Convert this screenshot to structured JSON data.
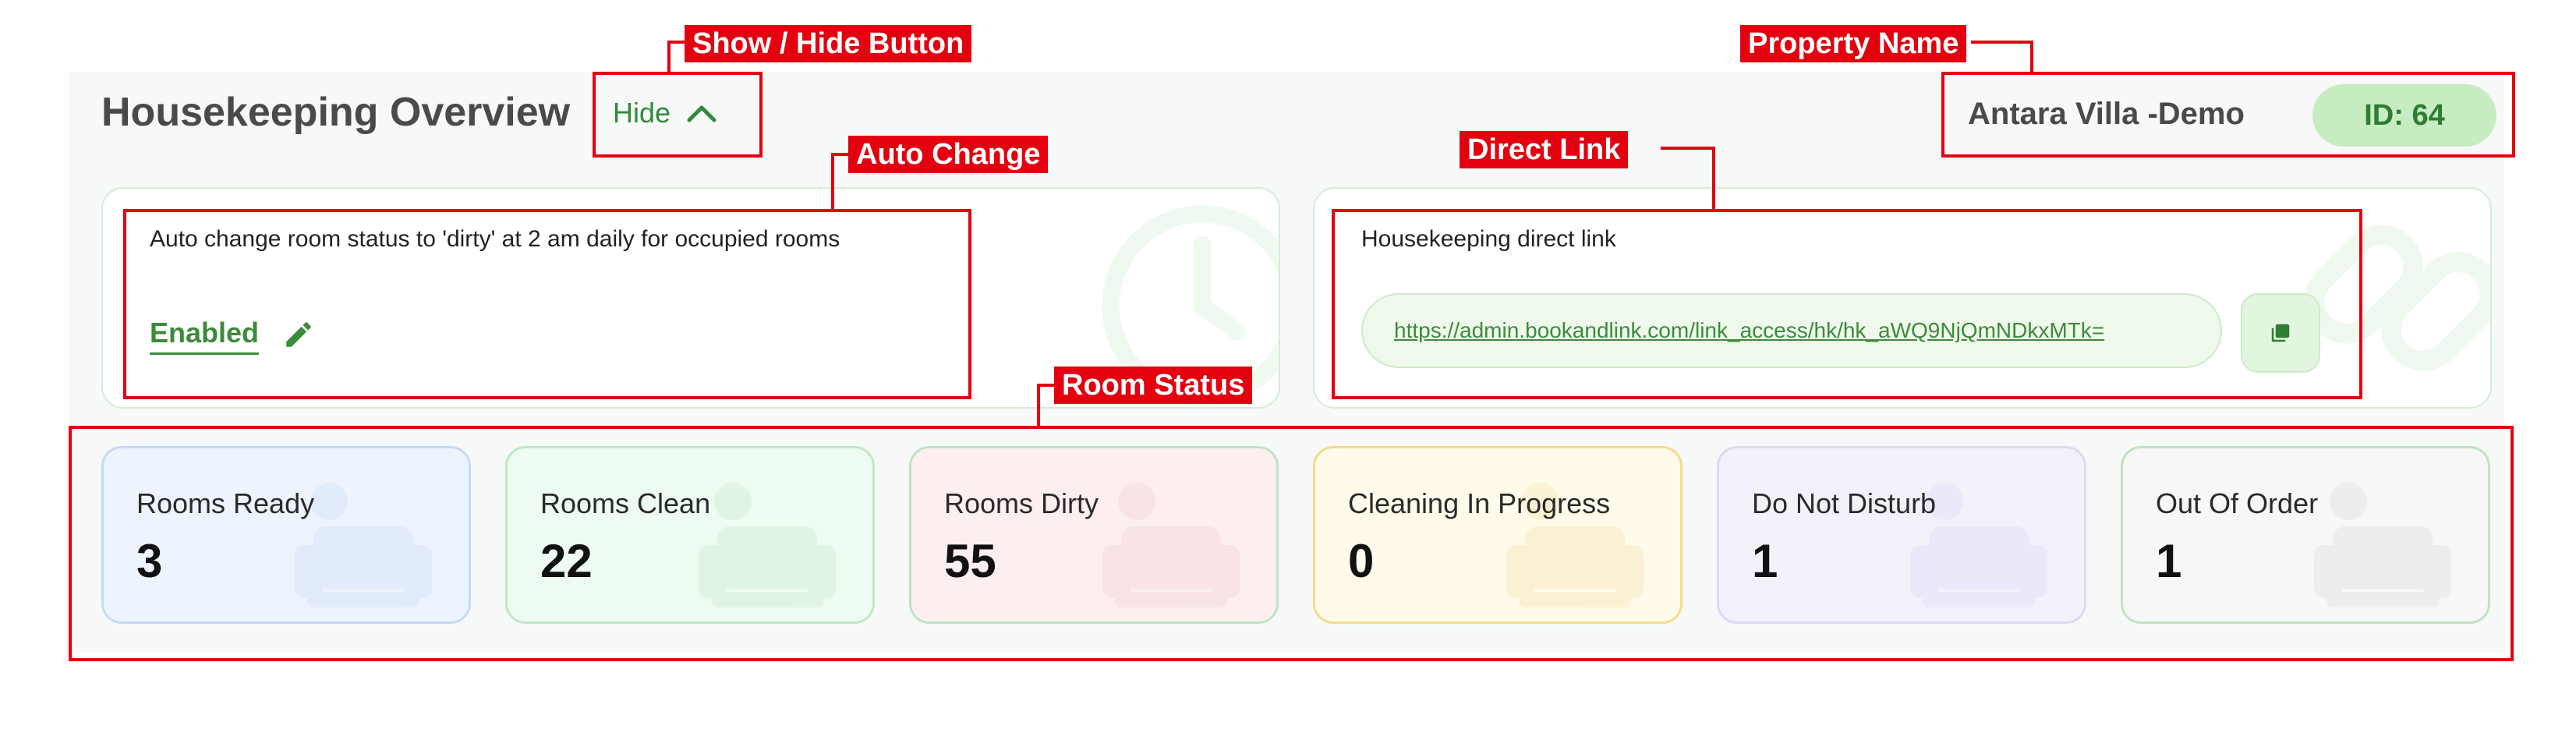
{
  "header": {
    "title": "Housekeeping Overview",
    "toggle_label": "Hide",
    "property_name": "Antara Villa -Demo",
    "property_id": "ID: 64"
  },
  "auto_change": {
    "description": "Auto change room status to 'dirty' at 2 am daily for occupied rooms",
    "status": "Enabled"
  },
  "direct_link": {
    "description": "Housekeeping direct link",
    "url": "https://admin.bookandlink.com/link_access/hk/hk_aWQ9NjQmNDkxMTk="
  },
  "room_status": [
    {
      "label": "Rooms Ready",
      "value": "3",
      "bg": "#eef4fd",
      "border": "#c5d9f5",
      "icon": "#d8e5f7"
    },
    {
      "label": "Rooms Clean",
      "value": "22",
      "bg": "#eefbf0",
      "border": "#bfe8c5",
      "icon": "#d6f0da"
    },
    {
      "label": "Rooms Dirty",
      "value": "55",
      "bg": "#fdeff0",
      "border": "#bfe3c3",
      "icon": "#f6dadd"
    },
    {
      "label": "Cleaning In Progress",
      "value": "0",
      "bg": "#fffaea",
      "border": "#f3dc8a",
      "icon": "#f7ebc3"
    },
    {
      "label": "Do Not Disturb",
      "value": "1",
      "bg": "#f3f2fb",
      "border": "#dcdaf0",
      "icon": "#e4e2f4"
    },
    {
      "label": "Out Of Order",
      "value": "1",
      "bg": "#f7f7f7",
      "border": "#bfe3c3",
      "icon": "#e6e6e6"
    }
  ],
  "annotations": {
    "show_hide": "Show / Hide Button",
    "property_name": "Property Name",
    "auto_change": "Auto Change",
    "direct_link": "Direct Link",
    "room_status": "Room Status"
  },
  "colors": {
    "accent": "#2e8b3a",
    "annotation": "#e3000f"
  },
  "icons": [
    "chevron-up-icon",
    "pencil-icon",
    "copy-icon",
    "clock-icon",
    "link-icon",
    "sofa-icon"
  ]
}
